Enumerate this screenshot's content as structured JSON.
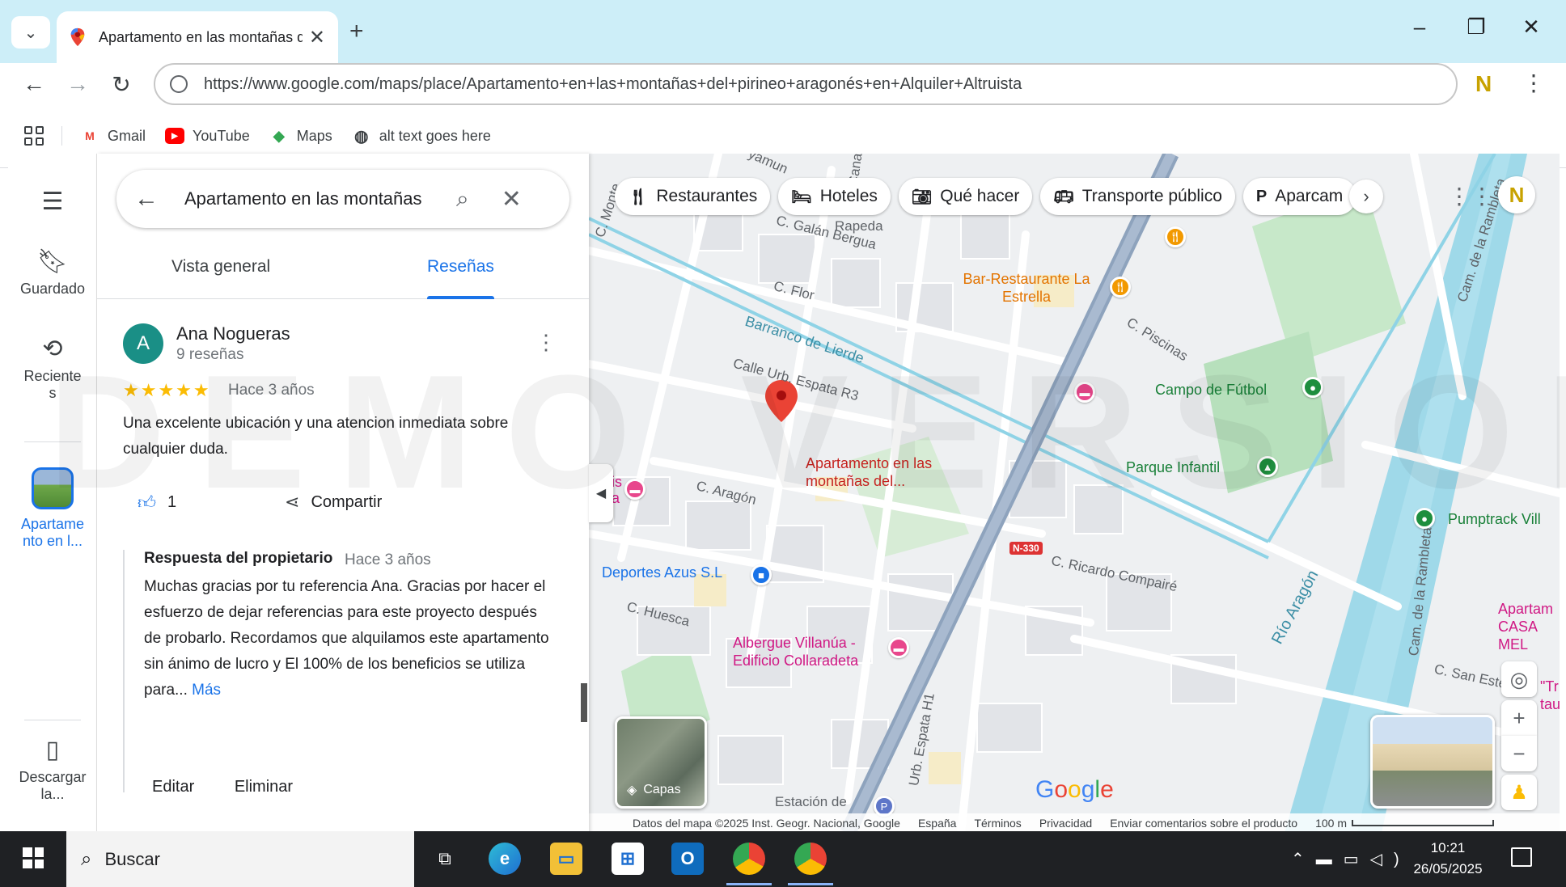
{
  "browser": {
    "tab_title": "Apartamento en las montañas del pirineo aragonés en Alquiler Altruista",
    "url": "https://www.google.com/maps/place/Apartamento+en+las+montañas+del+pirineo+aragonés+en+Alquiler+Altruista",
    "bookmarks": [
      {
        "label": "Gmail",
        "icon": "gmail-icon",
        "color": "#ea4335"
      },
      {
        "label": "YouTube",
        "icon": "youtube-icon",
        "color": "#ff0000"
      },
      {
        "label": "Maps",
        "icon": "maps-icon",
        "color": "#34a853"
      },
      {
        "label": "alt text goes here",
        "icon": "globe-icon",
        "color": "#202124"
      }
    ]
  },
  "rail": {
    "saved": "Guardado",
    "recent": "Reciente s",
    "place": "Apartame nto en l...",
    "download": "Descargar la..."
  },
  "panel": {
    "search_value": "Apartamento en las montañas",
    "tabs": [
      "Vista general",
      "Reseñas"
    ],
    "active_tab": "Reseñas",
    "review": {
      "avatar_letter": "A",
      "author": "Ana Nogueras",
      "review_count": "9 reseñas",
      "stars": 5,
      "stars_text": "★★★★★",
      "date": "Hace 3 años",
      "text": "Una excelente ubicación y una atencion inmediata sobre cualquier duda.",
      "likes": "1",
      "share": "Compartir",
      "owner_response_title": "Respuesta del propietario",
      "owner_response_date": "Hace 3 años",
      "owner_response_text": "Muchas gracias por tu referencia Ana. Gracias por hacer el esfuerzo de dejar referencias para este proyecto después de probarlo. Recordamos que alquilamos este apartamento sin ánimo de lucro y El 100% de los beneficios se utiliza para...",
      "more": "Más",
      "edit": "Editar",
      "delete": "Eliminar"
    }
  },
  "map": {
    "chips": [
      {
        "label": "Restaurantes",
        "icon": "fork-knife-icon"
      },
      {
        "label": "Hoteles",
        "icon": "bed-icon"
      },
      {
        "label": "Qué hacer",
        "icon": "camera-icon"
      },
      {
        "label": "Transporte público",
        "icon": "bus-icon"
      },
      {
        "label": "Aparcam",
        "icon": "parking-icon"
      }
    ],
    "streets": {
      "galan_bergua": "C. Galán Bergua",
      "flor": "C. Flor",
      "barranco": "Barranco de Lierde",
      "espata": "Calle Urb. Espata R3",
      "aragon": "C. Aragón",
      "huesca": "C. Huesca",
      "ricardo": "C. Ricardo Compairé",
      "piscinas": "C. Piscinas",
      "canal": "C. Canal de Izas",
      "rambleta1": "Cam. de la Rambleta",
      "rambleta2": "Cam. de la Rambleta",
      "rio": "Río Aragón",
      "san_esteban": "C. San Esteban",
      "espata_h1": "Urb. Espata H1",
      "n330": "N-330",
      "monte": "C. Monte",
      "rapeda": "Rapeda",
      "yamun": "yamun"
    },
    "pois": {
      "bar": "Bar-Restaurante La Estrella",
      "place": "Apartamento en las montañas del...",
      "campo": "Campo de Fútbol",
      "parque": "Parque Infantil",
      "pumptrack": "Pumptrack Vill",
      "deportes": "Deportes Azus S.L",
      "albergue": "Albergue Villanúa - Edificio Collaradeta",
      "estacion": "Estación de",
      "apart_casa": "Apartam CASA MEL",
      "tr": "\"Tr taur",
      "is_a": "is a"
    },
    "layers": "Capas",
    "google": "Google",
    "attribution": {
      "data": "Datos del mapa ©2025 Inst. Geogr. Nacional, Google",
      "country": "España",
      "terms": "Términos",
      "privacy": "Privacidad",
      "feedback": "Enviar comentarios sobre el producto",
      "scale": "100 m"
    },
    "watermark": "DEMO VERSION"
  },
  "taskbar": {
    "search": "Buscar",
    "time": "10:21",
    "date": "26/05/2025"
  }
}
